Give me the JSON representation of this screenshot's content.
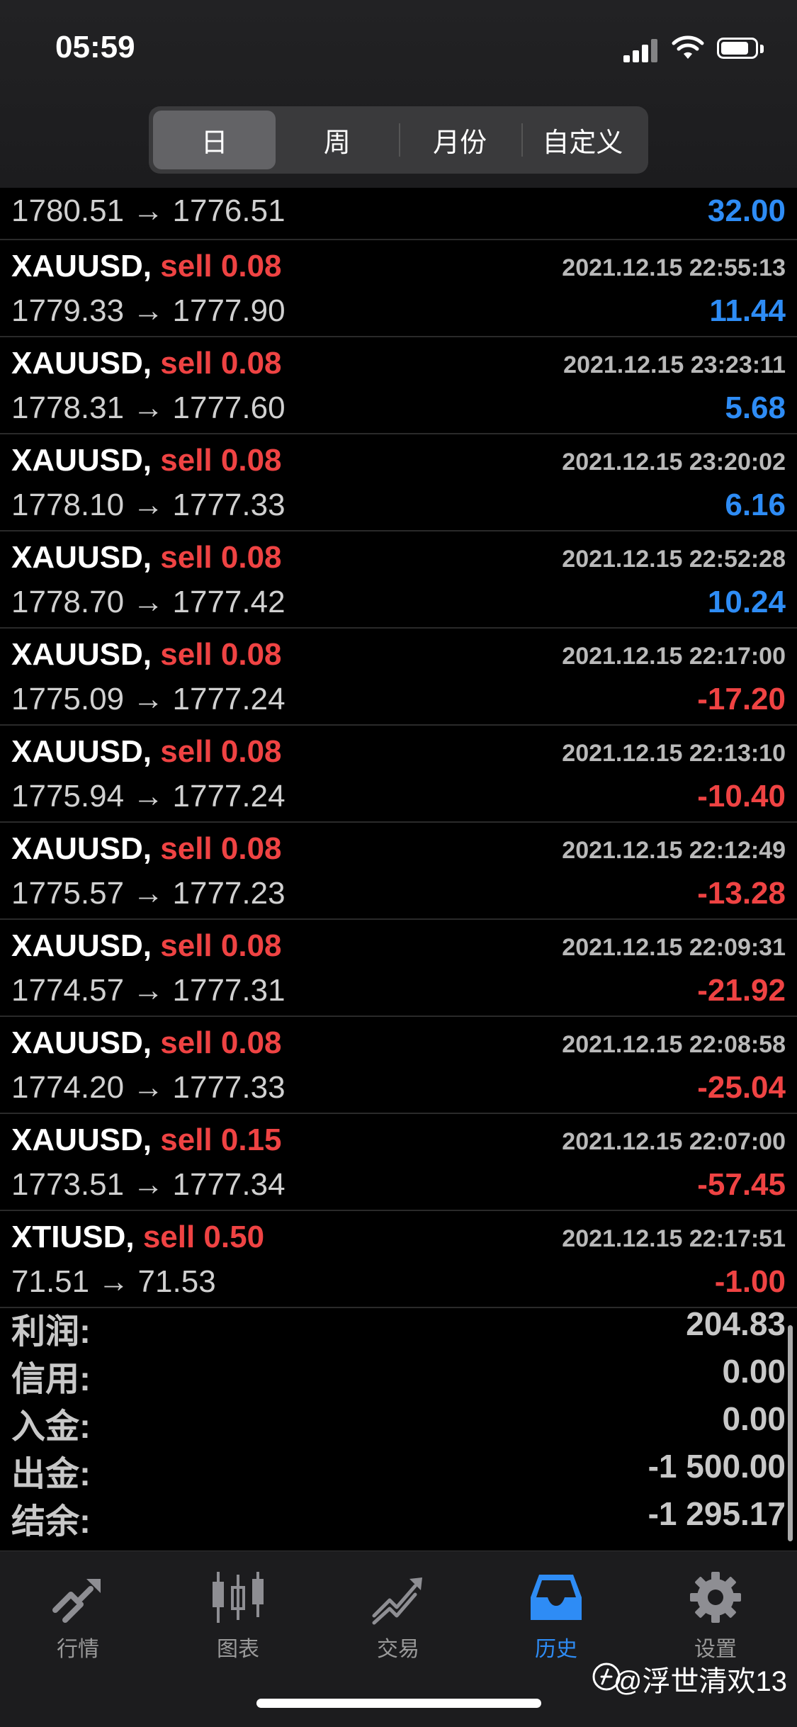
{
  "status_bar": {
    "time": "05:59"
  },
  "segments": [
    {
      "label": "日",
      "active": true
    },
    {
      "label": "周",
      "active": false
    },
    {
      "label": "月份",
      "active": false
    },
    {
      "label": "自定义",
      "active": false
    }
  ],
  "partial_row": {
    "prices": "1780.51 → 1776.51",
    "profit": "32.00"
  },
  "trades": [
    {
      "symbol": "XAUUSD,",
      "side": "sell 0.08",
      "date": "2021.12.15 22:55:13",
      "prices": "1779.33 → 1777.90",
      "profit": "11.44",
      "positive": true
    },
    {
      "symbol": "XAUUSD,",
      "side": "sell 0.08",
      "date": "2021.12.15 23:23:11",
      "prices": "1778.31 → 1777.60",
      "profit": "5.68",
      "positive": true
    },
    {
      "symbol": "XAUUSD,",
      "side": "sell 0.08",
      "date": "2021.12.15 23:20:02",
      "prices": "1778.10 → 1777.33",
      "profit": "6.16",
      "positive": true
    },
    {
      "symbol": "XAUUSD,",
      "side": "sell 0.08",
      "date": "2021.12.15 22:52:28",
      "prices": "1778.70 → 1777.42",
      "profit": "10.24",
      "positive": true
    },
    {
      "symbol": "XAUUSD,",
      "side": "sell 0.08",
      "date": "2021.12.15 22:17:00",
      "prices": "1775.09 → 1777.24",
      "profit": "-17.20",
      "positive": false
    },
    {
      "symbol": "XAUUSD,",
      "side": "sell 0.08",
      "date": "2021.12.15 22:13:10",
      "prices": "1775.94 → 1777.24",
      "profit": "-10.40",
      "positive": false
    },
    {
      "symbol": "XAUUSD,",
      "side": "sell 0.08",
      "date": "2021.12.15 22:12:49",
      "prices": "1775.57 → 1777.23",
      "profit": "-13.28",
      "positive": false
    },
    {
      "symbol": "XAUUSD,",
      "side": "sell 0.08",
      "date": "2021.12.15 22:09:31",
      "prices": "1774.57 → 1777.31",
      "profit": "-21.92",
      "positive": false
    },
    {
      "symbol": "XAUUSD,",
      "side": "sell 0.08",
      "date": "2021.12.15 22:08:58",
      "prices": "1774.20 → 1777.33",
      "profit": "-25.04",
      "positive": false
    },
    {
      "symbol": "XAUUSD,",
      "side": "sell 0.15",
      "date": "2021.12.15 22:07:00",
      "prices": "1773.51 → 1777.34",
      "profit": "-57.45",
      "positive": false
    },
    {
      "symbol": "XTIUSD,",
      "side": "sell 0.50",
      "date": "2021.12.15 22:17:51",
      "prices": "71.51 → 71.53",
      "profit": "-1.00",
      "positive": false
    }
  ],
  "summary": [
    {
      "label": "利润:",
      "value": "204.83"
    },
    {
      "label": "信用:",
      "value": "0.00"
    },
    {
      "label": "入金:",
      "value": "0.00"
    },
    {
      "label": "出金:",
      "value": "-1 500.00"
    },
    {
      "label": "结余:",
      "value": "-1 295.17"
    }
  ],
  "tabs": [
    {
      "label": "行情",
      "icon": "quotes-icon",
      "active": false
    },
    {
      "label": "图表",
      "icon": "chart-icon",
      "active": false
    },
    {
      "label": "交易",
      "icon": "trade-icon",
      "active": false
    },
    {
      "label": "历史",
      "icon": "history-icon",
      "active": true
    },
    {
      "label": "设置",
      "icon": "settings-icon",
      "active": false
    }
  ],
  "watermark": "@浮世清欢13",
  "colors": {
    "positive": "#2e8cf5",
    "negative": "#ef4343",
    "active_tab": "#2e8cf5"
  }
}
